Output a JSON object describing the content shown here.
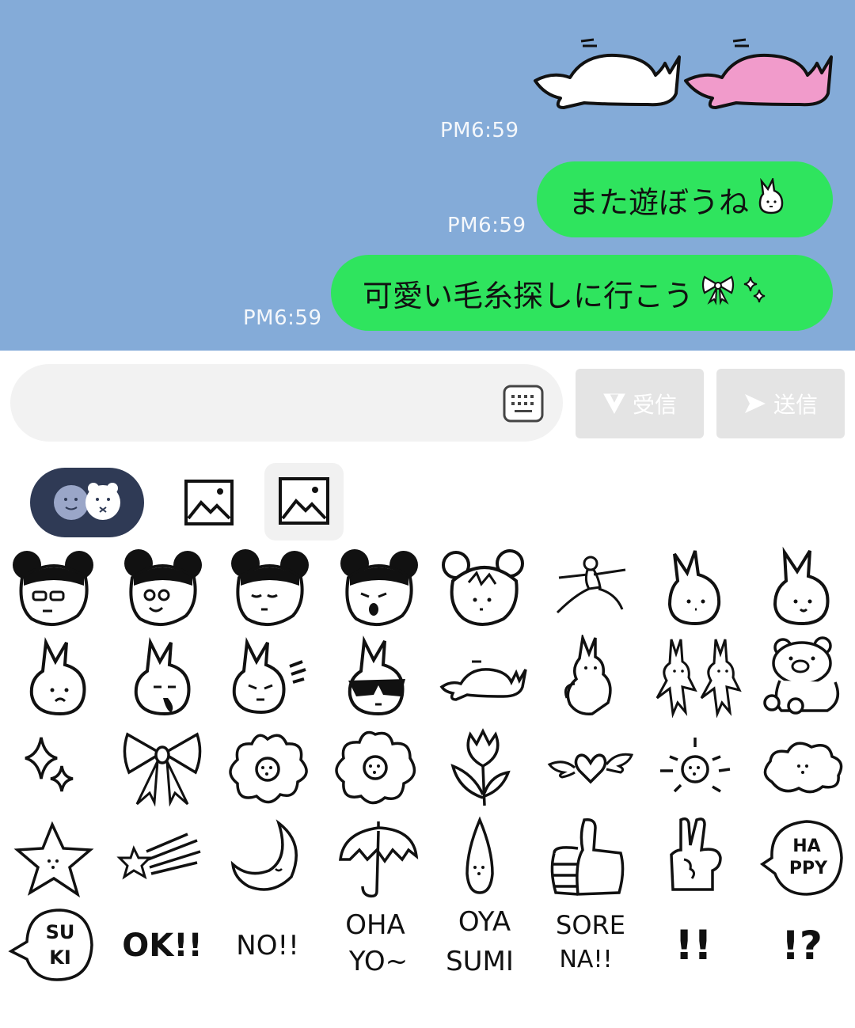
{
  "messages": [
    {
      "type": "sticker",
      "time": "PM6:59",
      "sticker": "two-sleeping-rabbits"
    },
    {
      "type": "text",
      "time": "PM6:59",
      "text": "また遊ぼうね",
      "emoji": "rabbit-emoji"
    },
    {
      "type": "text",
      "time": "PM6:59",
      "text": "可愛い毛糸探しに行こう",
      "emoji": "ribbon-sparkle-emoji"
    }
  ],
  "input": {
    "placeholder": "",
    "keyboard_icon": "keyboard-icon"
  },
  "buttons": {
    "receive": "受信",
    "send": "送信"
  },
  "tabs": [
    "emoji-pack-tab",
    "image-tab",
    "image-tab-selected"
  ],
  "colors": {
    "chat_bg": "#84abd8",
    "bubble": "#2fe45e",
    "tab_active": "#2f3a55"
  },
  "emoji_grid": [
    [
      "girl-glasses",
      "girl-smile",
      "girl-sleepy",
      "girl-yawn",
      "girl-bear-ears",
      "jumping-person",
      "rabbit-face",
      "rabbit-smile"
    ],
    [
      "rabbit-sad",
      "rabbit-drool",
      "rabbit-angry",
      "rabbit-sunglasses",
      "rabbit-lying",
      "rabbit-sitting",
      "two-rabbits",
      "bear-sitting"
    ],
    [
      "sparkles",
      "ribbon",
      "flower",
      "flower-2",
      "tulip",
      "winged-heart",
      "sun",
      "cloud"
    ],
    [
      "star",
      "shooting-star",
      "crescent-moon",
      "umbrella",
      "drop",
      "thumbs-up",
      "peace-sign",
      "happy-bubble"
    ],
    [
      "suki-bubble",
      "ok-text",
      "no-text",
      "ohayo-text",
      "oyasumi-text",
      "sorena-text",
      "double-exclamation",
      "exclamation-question"
    ]
  ],
  "emoji_text": {
    "happy": "HA PPY",
    "suki": "SU KI",
    "ok": "OK!!",
    "no": "NO!!",
    "ohayo1": "OHA",
    "ohayo2": "YO~",
    "oyasumi1": "OYA",
    "oyasumi2": "SUMI",
    "sorena1": "SORE",
    "sorena2": "NA!!",
    "excl": "!!",
    "exq": "!?"
  }
}
